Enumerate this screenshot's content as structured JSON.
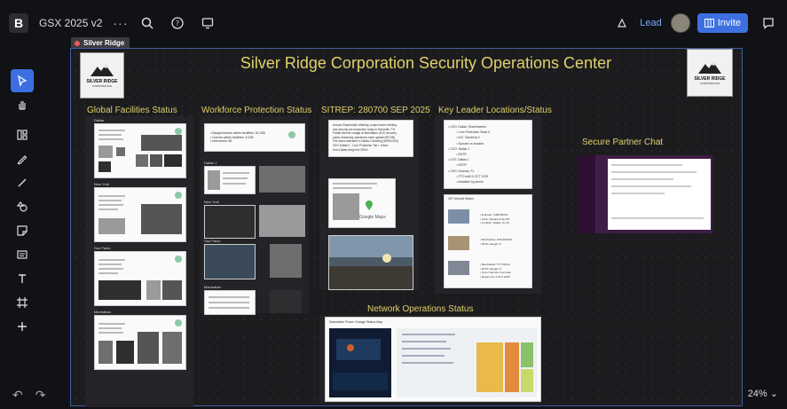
{
  "topbar": {
    "logo": "B",
    "board_title": "GSX 2025 v2",
    "more": "···",
    "lead": "Lead",
    "invite": "Invite"
  },
  "frame": {
    "label": "Silver Ridge",
    "title": "Silver Ridge Corporation Security Operations Center"
  },
  "corp_logo": {
    "line1": "SILVER RIDGE",
    "line2": "CORPORATION"
  },
  "sections": {
    "facilities": "Global Facilities Status",
    "workforce": "Workforce Protection Status",
    "sitrep": "SITREP: 280700 SEP 2025",
    "leaders": "Key Leader Locations/Status",
    "chat": "Secure Partner Chat",
    "network": "Network Operations Status"
  },
  "facility_cards": [
    "Dallas",
    "New York",
    "Sao Paulo",
    "Manhattan"
  ],
  "workforce_cards": [
    "Dallas 1",
    "New York",
    "Sao Paulo",
    "Manhattan"
  ],
  "workforce_summary": "• Badge/visitors within facilities: 62,306\n• Guests within facilities: 6,536\n• Interviews: 85",
  "sitrep_text": "Annual Shareholder Meeting: project team meeting\nand security pre-inspection today in Nashville, TN\nPartial internet outage at Manhattan, ADS recovery\npublic streaming operations need update (BF:DN)\nFire alarm activated in Dallas 2 building (WEB:1900)\nCEO Dallas II - Core Protection Tier I: return\nfrom Dallas tonight at 2200z",
  "sitrep_map_label": "Google Maps",
  "leaders_text": "• CEO: Dallas, Shareholders\n          • Core Protection Team II\n          • A/C: Gardenia 2\n          • Spouse on location\n• COO: Dallas 1\n          • NSTR\n• CFO: Dallas 1\n          • NSTR\n• CRO: Orlando, FL\n          • PTO until 3 OCT 2025\n          • Available by phone",
  "aircraft": {
    "header": "VIP Aircraft Status",
    "items": [
      "• Embraer: SJ9RTE034\n• Crew: Signature W-278\n• Location: Dallas, On 4h",
      "• Bombardier: DSK44FN32\n• DTW: Hangar 17",
      "• Bombardier: TT7YNF34\n• DTW: Hangar 17\n• Out of Service: Fuel leak\n• Repair eta: 4 OCT 2025"
    ]
  },
  "network_card_title": "Manhattan Power Outage Status Map",
  "zoom": "24%",
  "colors": {
    "accent": "#3d6fe0",
    "title": "#e0d16a",
    "frame_border": "#3c5ea0"
  }
}
